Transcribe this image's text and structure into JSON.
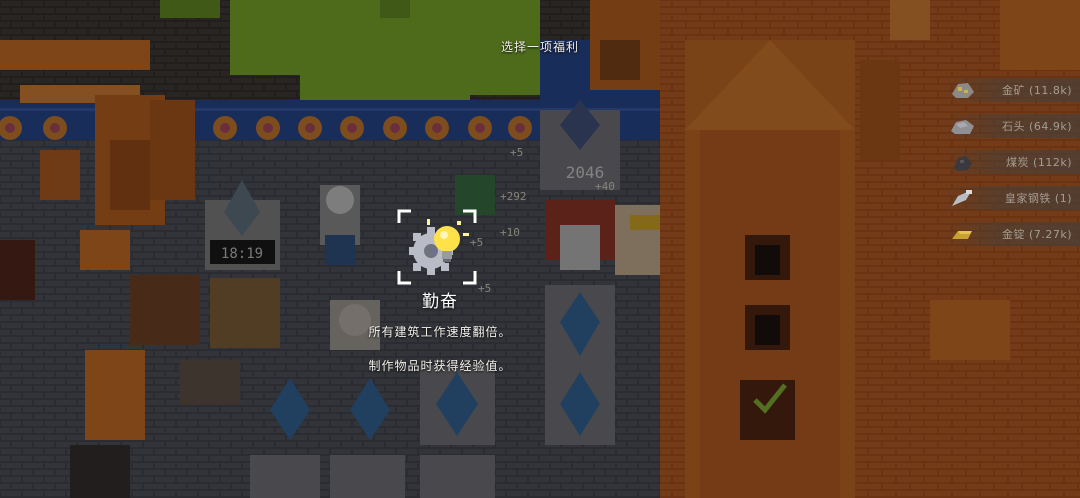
{
  "prompt": {
    "title": "选择一项福利"
  },
  "perk": {
    "name": "勤奋",
    "icon": "lightbulb-gear-icon",
    "descriptions": [
      "所有建筑工作速度翻倍。",
      "制作物品时获得经验值。"
    ]
  },
  "resources": [
    {
      "label": "金矿 (11.8k)",
      "icon": "gold-ore-icon"
    },
    {
      "label": "石头 (64.9k)",
      "icon": "stone-icon"
    },
    {
      "label": "煤炭 (112k)",
      "icon": "coal-icon"
    },
    {
      "label": "皇家钢铁 (1)",
      "icon": "royal-steel-icon"
    },
    {
      "label": "金锭 (7.27k)",
      "icon": "gold-ingot-icon"
    }
  ],
  "scene": {
    "clock_text": "18:19",
    "counter_text": "2046",
    "plus_labels": [
      "+5",
      "+292",
      "+40",
      "+5",
      "+5",
      "+10"
    ]
  },
  "colors": {
    "background": "#1d1a17",
    "overlay": "rgba(0,0,0,0.45)",
    "accent_orange": "#d8772a",
    "grass_green": "#86b82f",
    "water_blue": "#2b4e9c",
    "text_white": "#f2eee8",
    "resource_text": "#a49d93"
  }
}
